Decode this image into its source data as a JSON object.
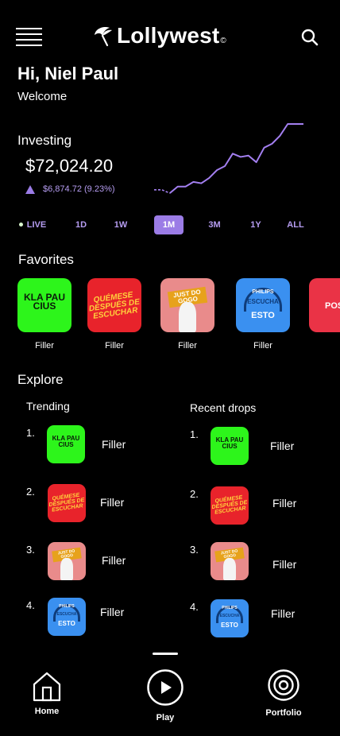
{
  "header": {
    "brand": "Lollywest",
    "brand_mark": "©"
  },
  "greeting": {
    "title": "Hi, Niel Paul",
    "subtitle": "Welcome"
  },
  "investing": {
    "label": "Investing",
    "amount": "$72,024.20",
    "change": "$6,874.72 (9.23%)",
    "trend": "up"
  },
  "chart_data": {
    "type": "line",
    "x": [
      0,
      1,
      2,
      3,
      4,
      5,
      6,
      7,
      8,
      9,
      10,
      11,
      12,
      13,
      14,
      15,
      16,
      17,
      18,
      19
    ],
    "values": [
      0.0,
      0.0,
      -0.05,
      0.05,
      0.05,
      0.12,
      0.1,
      0.18,
      0.3,
      0.36,
      0.55,
      0.5,
      0.52,
      0.42,
      0.64,
      0.7,
      0.82,
      1.0,
      1.0,
      1.0
    ],
    "y_normalized": true,
    "color": "#a37ff0",
    "title": "",
    "xlabel": "",
    "ylabel": ""
  },
  "ranges": {
    "items": [
      "LIVE",
      "1D",
      "1W",
      "1M",
      "3M",
      "1Y",
      "ALL"
    ],
    "selected": "1M"
  },
  "favorites": {
    "title": "Favorites",
    "items": [
      {
        "label": "Filler",
        "art": "klaps"
      },
      {
        "label": "Filler",
        "art": "quemese"
      },
      {
        "label": "Filler",
        "art": "justdogo"
      },
      {
        "label": "Filler",
        "art": "philips"
      },
      {
        "label": "",
        "art": "post"
      }
    ]
  },
  "explore": {
    "title": "Explore",
    "trending": {
      "title": "Trending",
      "items": [
        {
          "num": "1.",
          "label": "Filler",
          "art": "klaps"
        },
        {
          "num": "2.",
          "label": "Filler",
          "art": "quemese"
        },
        {
          "num": "3.",
          "label": "Filler",
          "art": "justdogo"
        },
        {
          "num": "4.",
          "label": "Filler",
          "art": "philips"
        }
      ]
    },
    "recent": {
      "title": "Recent drops",
      "items": [
        {
          "num": "1.",
          "label": "Filler",
          "art": "klaps"
        },
        {
          "num": "2.",
          "label": "Filler",
          "art": "quemese"
        },
        {
          "num": "3.",
          "label": "Filler",
          "art": "justdogo"
        },
        {
          "num": "4.",
          "label": "Filler",
          "art": "philips"
        }
      ]
    }
  },
  "art": {
    "klaps": "KLA PAU CIUS",
    "quemese": "QUÉMESE DESPUÉS DE ESCUCHAR",
    "justdogo": "JUST DO GOGO",
    "philips_top": "PHILIPS",
    "philips_mid": "ESCUCHA",
    "philips_bottom": "ESTO",
    "post": "POST"
  },
  "nav": {
    "home": "Home",
    "play": "Play",
    "portfolio": "Portfolio"
  },
  "colors": {
    "accent": "#9b7ce6",
    "background": "#000000"
  }
}
